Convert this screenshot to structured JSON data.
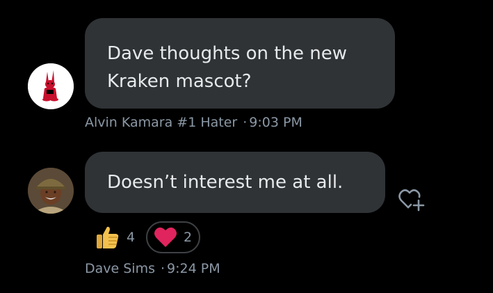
{
  "messages": [
    {
      "text_line1": "Dave thoughts on the new",
      "text_line2": "Kraken mascot?",
      "sender": "Alvin Kamara #1 Hater",
      "time": "9:03 PM"
    },
    {
      "text": "Doesn’t interest me at all.",
      "sender": "Dave Sims",
      "time": "9:24 PM",
      "reactions": {
        "thumbs_up_count": "4",
        "heart_count": "2"
      }
    }
  ],
  "meta_separator": "·",
  "icons": {
    "avatar1": "red-mascot-avatar-icon",
    "avatar2": "user-photo-avatar-icon",
    "thumbs_up": "thumbs-up-icon",
    "heart": "heart-icon",
    "add_reaction": "add-reaction-heart-icon"
  },
  "colors": {
    "background": "#000000",
    "bubble": "#2f3336",
    "text": "#e7e9ea",
    "muted": "#8b98a5",
    "heart": "#e0245e",
    "thumbs": "#f2c14e"
  }
}
